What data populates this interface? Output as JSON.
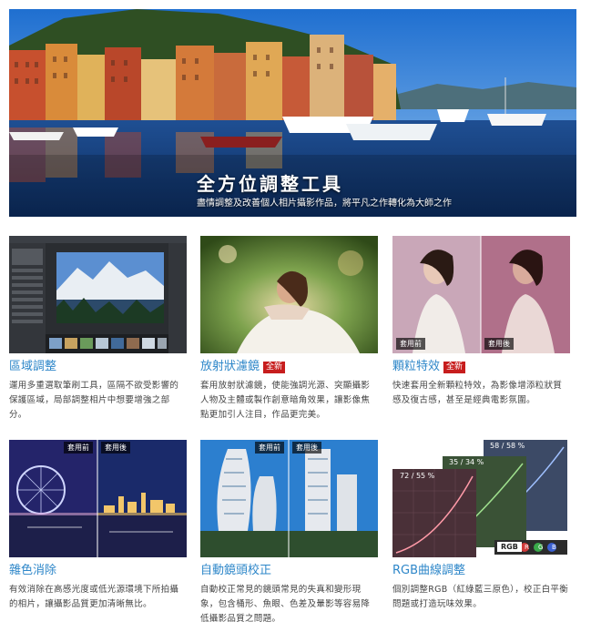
{
  "hero": {
    "title": "全方位調整工具",
    "subtitle": "盡情調整及改善個人相片攝影作品，將平凡之作轉化為大師之作"
  },
  "cards": [
    {
      "title": "區域調整",
      "badge": "",
      "desc": "運用多重選取筆刷工具，區隔不欲受影響的保護區域，局部調整相片中想要增強之部分。"
    },
    {
      "title": "放射狀濾鏡",
      "badge": "全新",
      "desc": "套用放射狀濾鏡，使能強調光源、突顯攝影人物及主體或製作創意暗角效果，讓影像焦點更加引人注目，作品更完美。"
    },
    {
      "title": "顆粒特效",
      "badge": "全新",
      "desc": "快速套用全新顆粒特效，為影像增添粒狀質感及復古感，甚至是經典電影氛圍。",
      "before_label": "套用前",
      "after_label": "套用後"
    },
    {
      "title": "雜色消除",
      "badge": "",
      "desc": "有效消除在高感光度或低光源環境下所拍攝的相片，讓攝影品質更加清晰無比。",
      "before_label": "套用前",
      "after_label": "套用後"
    },
    {
      "title": "自動鏡頭校正",
      "badge": "",
      "desc": "自動校正常見的鏡頭常見的失真和變形現象，包含桶形、魚眼、色差及暈影等容易降低攝影品質之問題。",
      "before_label": "套用前",
      "after_label": "套用後"
    },
    {
      "title": "RGB曲線調整",
      "badge": "",
      "desc": "個別調整RGB（紅綠藍三原色），校正白平衡問題或打造玩味效果。",
      "curve_labels": [
        "72 / 55 %",
        "35 / 34 %",
        "58 / 58 %"
      ],
      "rgb_label": "RGB",
      "channel_labels": [
        "R",
        "G",
        "B"
      ]
    }
  ],
  "colors": {
    "accent": "#2e87c9",
    "badge": "#c71d1d",
    "text": "#444444"
  }
}
